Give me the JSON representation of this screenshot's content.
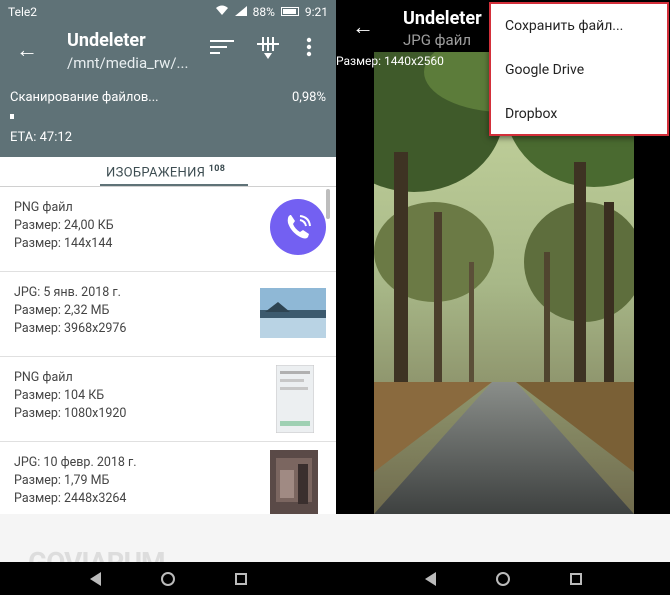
{
  "left": {
    "status": {
      "carrier": "Tele2",
      "battery": "88%",
      "time": "9:21"
    },
    "appbar": {
      "title": "Undeleter",
      "subtitle": "/mnt/media_rw/..."
    },
    "scan": {
      "text": "Сканирование файлов...",
      "percent": "0,98%",
      "progress_fraction": 0.0098,
      "eta": "ETA: 47:12"
    },
    "tab": {
      "label": "ИЗОБРАЖЕНИЯ",
      "count": "108"
    },
    "items": [
      {
        "line1": "PNG файл",
        "line2": "Размер: 24,00 КБ",
        "line3": "Размер: 144x144",
        "thumb": "viber-icon"
      },
      {
        "line1": "JPG: 5 янв. 2018 г.",
        "line2": "Размер: 2,32 МБ",
        "line3": "Размер: 3968x2976",
        "thumb": "landscape-photo"
      },
      {
        "line1": "PNG файл",
        "line2": "Размер: 104 КБ",
        "line3": "Размер: 1080x1920",
        "thumb": "screenshot"
      },
      {
        "line1": "JPG: 10 февр. 2018 г.",
        "line2": "Размер: 1,79 МБ",
        "line3": "Размер: 2448x3264",
        "thumb": "dark-photo"
      }
    ],
    "watermark": "GOVIARUM"
  },
  "right": {
    "appbar": {
      "title": "Undeleter",
      "subtitle": "JPG файл"
    },
    "resolution": "Размер: 1440x2560",
    "menu": [
      "Сохранить файл...",
      "Google Drive",
      "Dropbox"
    ],
    "menu_highlight_color": "#d32f3a"
  },
  "colors": {
    "appbar": "#5f7277",
    "accent": "#7360f2"
  }
}
